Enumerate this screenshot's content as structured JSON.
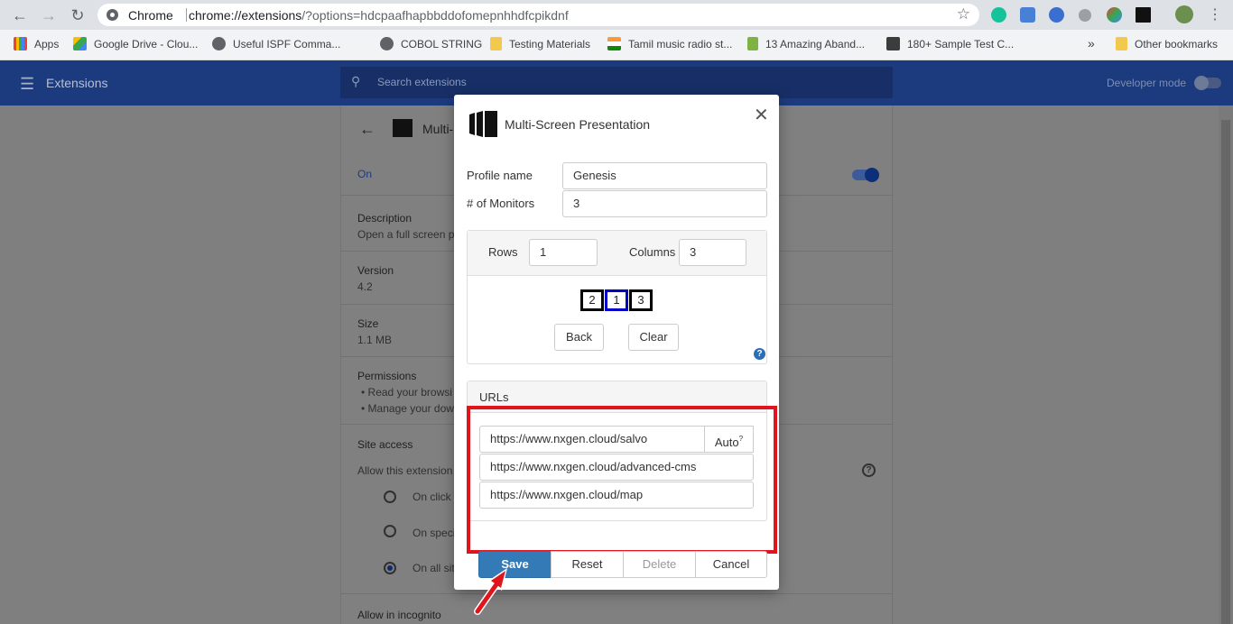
{
  "browser": {
    "scheme_label": "Chrome",
    "url_host": "chrome://extensions",
    "url_rest": "/?options=hdcpaafhapbbddofomepnhhdfcpikdnf"
  },
  "bookmarks": [
    {
      "label": "Apps",
      "icon": "apps-grid-icon"
    },
    {
      "label": "Google Drive - Clou...",
      "icon": "google-drive-icon"
    },
    {
      "label": "Useful ISPF Comma...",
      "icon": "globe-icon"
    },
    {
      "label": "COBOL STRING",
      "icon": "globe-icon"
    },
    {
      "label": "Testing Materials",
      "icon": "folder-icon"
    },
    {
      "label": "Tamil music radio st...",
      "icon": "india-flag-icon"
    },
    {
      "label": "13 Amazing Aband...",
      "icon": "dollar-icon"
    },
    {
      "label": "180+ Sample Test C...",
      "icon": "site-icon"
    },
    {
      "label": "»",
      "icon": "overflow-icon"
    },
    {
      "label": "Other bookmarks",
      "icon": "folder-icon"
    }
  ],
  "ext_header": {
    "title": "Extensions",
    "search_placeholder": "Search extensions",
    "developer_mode": "Developer mode"
  },
  "ext_card": {
    "name_partial": "Multi-S",
    "on_label": "On",
    "description_label": "Description",
    "description_text": "Open a full screen pr",
    "version_label": "Version",
    "version_value": "4.2",
    "size_label": "Size",
    "size_value": "1.1 MB",
    "permissions_label": "Permissions",
    "permission_1": "Read your browsi",
    "permission_2": "Manage your dow",
    "site_access_label": "Site access",
    "allow_text": "Allow this extension t",
    "option_1": "On click",
    "option_2": "On specif",
    "option_3": "On all sit",
    "incognito_label": "Allow in incognito"
  },
  "dialog": {
    "title": "Multi-Screen Presentation",
    "profile_name_label": "Profile name",
    "profile_name_value": "Genesis",
    "monitors_label": "# of Monitors",
    "monitors_value": "3",
    "rows_label": "Rows",
    "rows_value": "1",
    "columns_label": "Columns",
    "columns_value": "3",
    "monitor_cells": [
      "2",
      "1",
      "3"
    ],
    "back_label": "Back",
    "clear_label": "Clear",
    "urls_title": "URLs",
    "urls": [
      "https://www.nxgen.cloud/salvo",
      "https://www.nxgen.cloud/advanced-cms",
      "https://www.nxgen.cloud/map"
    ],
    "auto_label": "Auto",
    "auto_sup": "?",
    "save_label": "Save",
    "reset_label": "Reset",
    "delete_label": "Delete",
    "cancel_label": "Cancel"
  },
  "colors": {
    "primary": "#337ab7",
    "highlight": "#e0141c",
    "selected_monitor": "#0000c8"
  }
}
